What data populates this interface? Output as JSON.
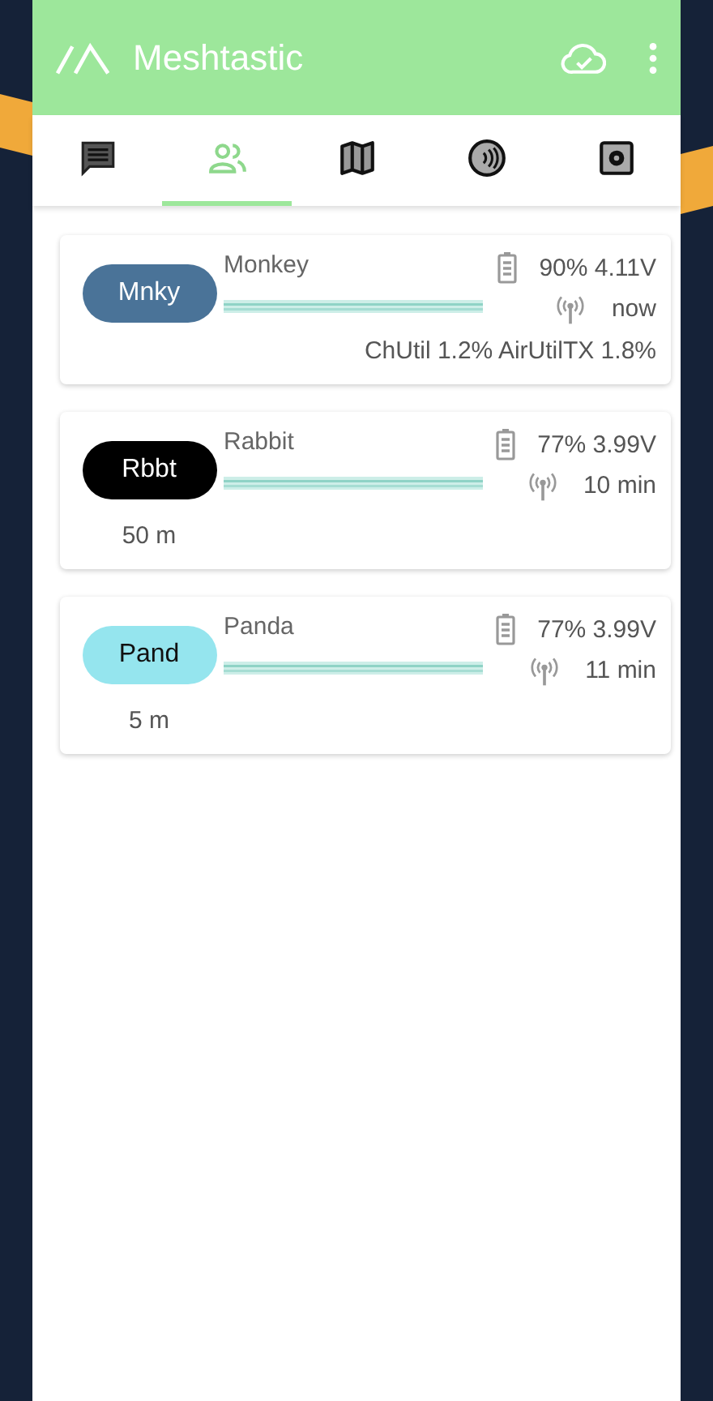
{
  "app_bar": {
    "title": "Meshtastic"
  },
  "tabs": [
    {
      "kind": "messages",
      "selected": false
    },
    {
      "kind": "nodes",
      "selected": true
    },
    {
      "kind": "map",
      "selected": false
    },
    {
      "kind": "channel",
      "selected": false
    },
    {
      "kind": "settings",
      "selected": false
    }
  ],
  "nodes": [
    {
      "short_name": "Mnky",
      "long_name": "Monkey",
      "color": "#4a7398",
      "battery": "90% 4.11V",
      "last_heard": "now",
      "utilization": "ChUtil 1.2% AirUtilTX 1.8%"
    },
    {
      "short_name": "Rbbt",
      "long_name": "Rabbit",
      "color": "#000000",
      "battery": "77% 3.99V",
      "last_heard": "10 min",
      "distance": "50 m"
    },
    {
      "short_name": "Pand",
      "long_name": "Panda",
      "color": "#95e5ee",
      "battery": "77% 3.99V",
      "last_heard": "11 min",
      "distance": "5 m"
    }
  ]
}
